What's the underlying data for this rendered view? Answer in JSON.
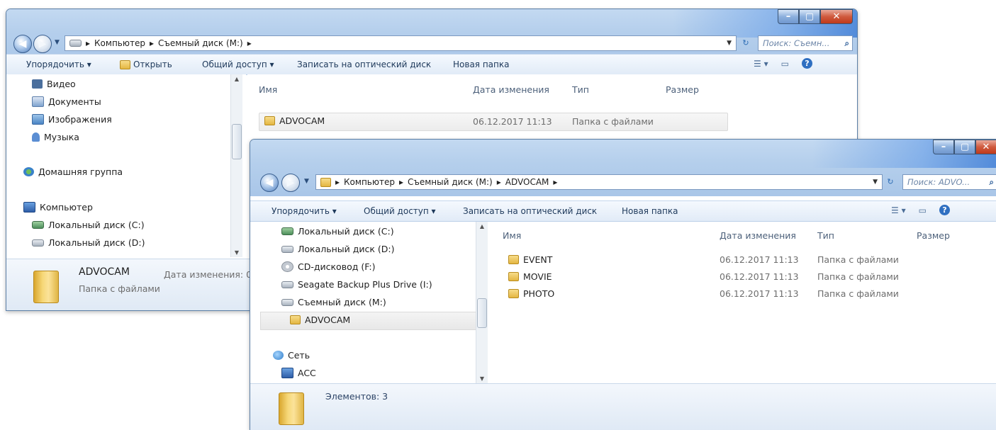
{
  "back_window": {
    "address": [
      "Компьютер",
      "Съемный диск (M:)"
    ],
    "search_placeholder": "Поиск: Съемн...",
    "commands": [
      "Упорядочить ▾",
      "Открыть",
      "Общий доступ ▾",
      "Записать на оптический диск",
      "Новая папка"
    ],
    "nav_items": [
      {
        "label": "Видео",
        "icon": "video-icon"
      },
      {
        "label": "Документы",
        "icon": "documents-icon"
      },
      {
        "label": "Изображения",
        "icon": "pictures-icon"
      },
      {
        "label": "Музыка",
        "icon": "music-icon"
      },
      {
        "label": "Домашняя группа",
        "icon": "homegroup-icon"
      },
      {
        "label": "Компьютер",
        "icon": "computer-icon"
      },
      {
        "label": "Локальный диск (C:)",
        "icon": "drive-icon"
      },
      {
        "label": "Локальный диск (D:)",
        "icon": "drive-icon"
      }
    ],
    "columns": [
      "Имя",
      "Дата изменения",
      "Тип",
      "Размер"
    ],
    "rows": [
      {
        "name": "ADVOCAM",
        "date": "06.12.2017 11:13",
        "type": "Папка с файлами"
      }
    ],
    "details": {
      "name": "ADVOCAM",
      "type": "Папка с файлами",
      "date_label": "Дата изменения: 0"
    }
  },
  "front_window": {
    "address": [
      "Компьютер",
      "Съемный диск (M:)",
      "ADVOCAM"
    ],
    "search_placeholder": "Поиск: ADVO...",
    "commands": [
      "Упорядочить ▾",
      "Общий доступ ▾",
      "Записать на оптический диск",
      "Новая папка"
    ],
    "nav_items": [
      {
        "label": "Локальный диск (C:)",
        "icon": "drive-icon"
      },
      {
        "label": "Локальный диск (D:)",
        "icon": "drive-icon"
      },
      {
        "label": "CD-дисковод (F:)",
        "icon": "cd-drive-icon"
      },
      {
        "label": "Seagate Backup Plus Drive (I:)",
        "icon": "drive-icon"
      },
      {
        "label": "Съемный диск (M:)",
        "icon": "drive-icon"
      },
      {
        "label": "ADVOCAM",
        "icon": "folder-icon"
      },
      {
        "label": "Сеть",
        "icon": "network-icon"
      },
      {
        "label": "ACC",
        "icon": "computer-icon"
      }
    ],
    "columns": [
      "Имя",
      "Дата изменения",
      "Тип",
      "Размер"
    ],
    "rows": [
      {
        "name": "EVENT",
        "date": "06.12.2017 11:13",
        "type": "Папка с файлами"
      },
      {
        "name": "MOVIE",
        "date": "06.12.2017 11:13",
        "type": "Папка с файлами"
      },
      {
        "name": "PHOTO",
        "date": "06.12.2017 11:13",
        "type": "Папка с файлами"
      }
    ],
    "details": {
      "count": "Элементов: 3"
    }
  }
}
